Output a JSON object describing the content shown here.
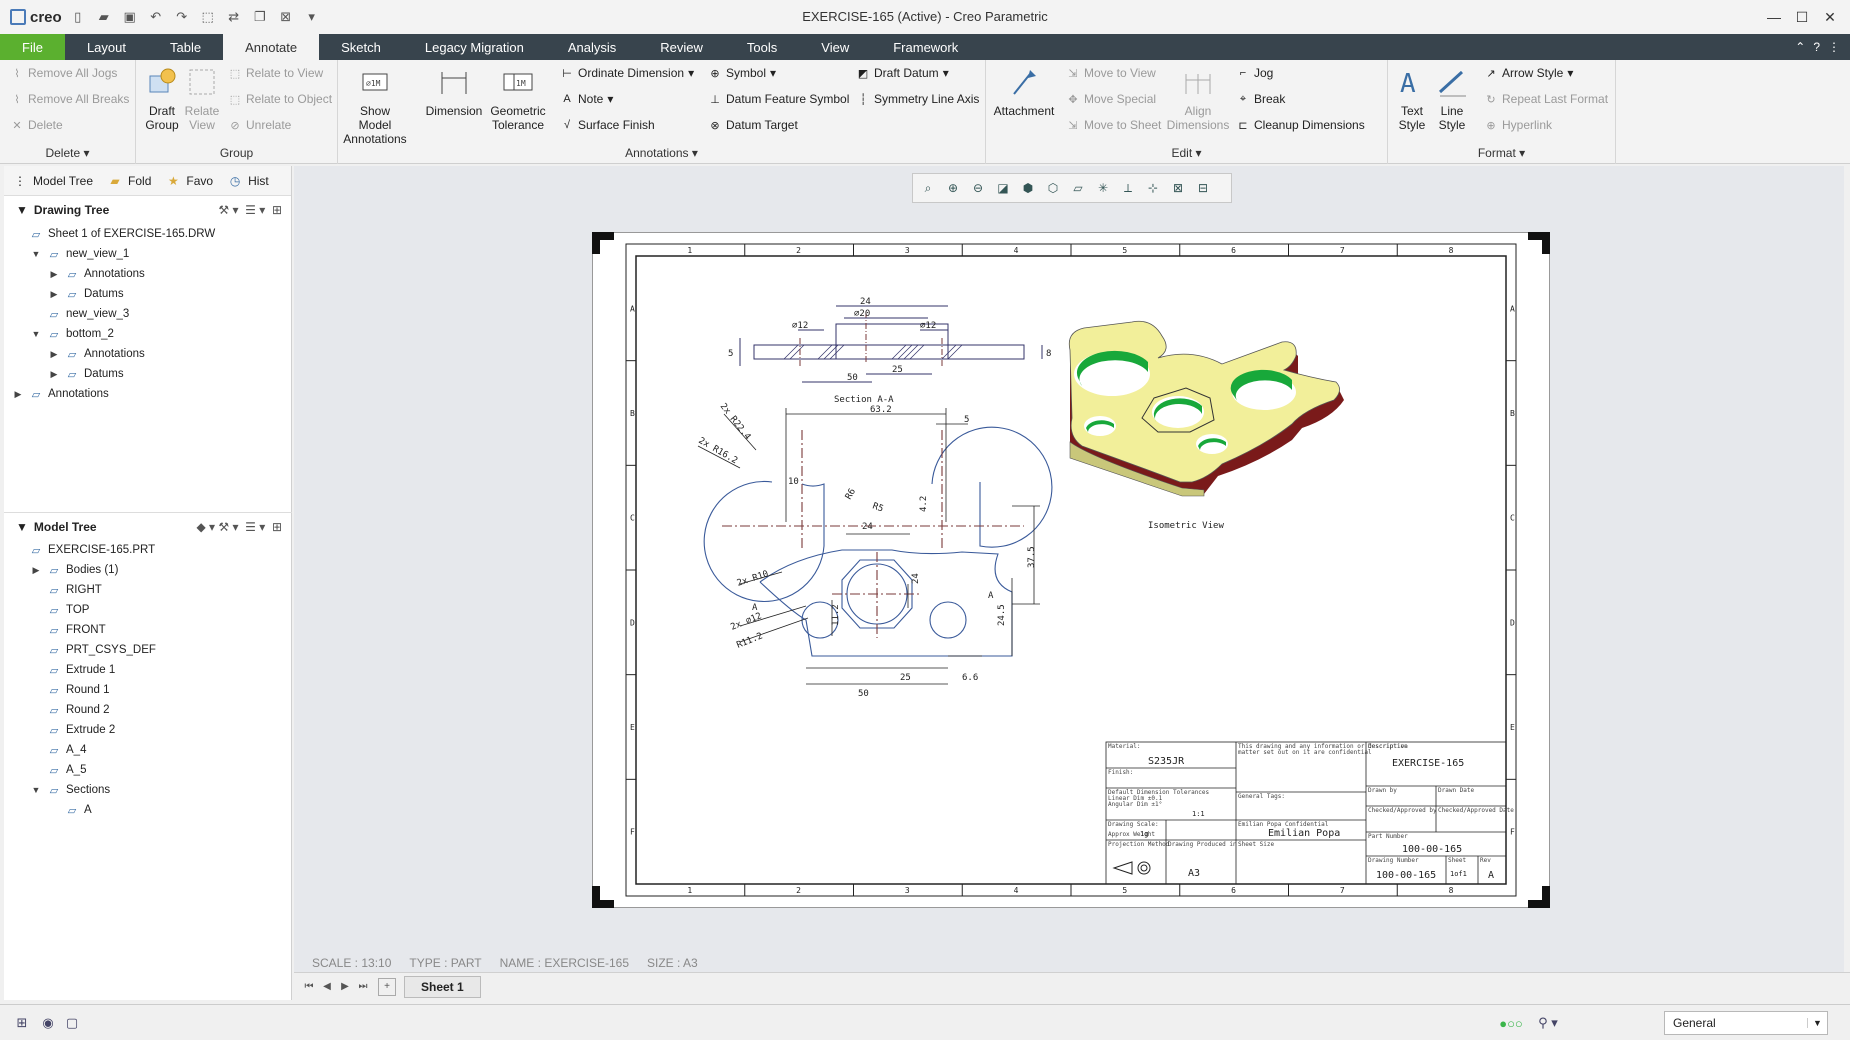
{
  "window": {
    "title": "EXERCISE-165 (Active) - Creo Parametric",
    "app": "creo"
  },
  "tabs": [
    "File",
    "Layout",
    "Table",
    "Annotate",
    "Sketch",
    "Legacy Migration",
    "Analysis",
    "Review",
    "Tools",
    "View",
    "Framework"
  ],
  "ribbon": {
    "delete": {
      "label": "Delete",
      "remove_all_jogs": "Remove All Jogs",
      "remove_all_breaks": "Remove All Breaks",
      "delete": "Delete"
    },
    "group": {
      "label": "Group",
      "draft_group": "Draft Group",
      "relate_view": "Relate View",
      "relate_to_view": "Relate to View",
      "relate_to_object": "Relate to Object",
      "unrelate": "Unrelate"
    },
    "annotations": {
      "label": "Annotations",
      "show_model_annotations": "Show Model Annotations",
      "dimension": "Dimension",
      "geometric_tolerance": "Geometric Tolerance",
      "ordinate_dimension": "Ordinate Dimension",
      "note": "Note",
      "surface_finish": "Surface Finish",
      "symbol": "Symbol",
      "datum_feature_symbol": "Datum Feature Symbol",
      "datum_target": "Datum Target",
      "draft_datum": "Draft Datum",
      "symmetry_line_axis": "Symmetry Line Axis"
    },
    "edit": {
      "label": "Edit",
      "attachment": "Attachment",
      "move_to_view": "Move to View",
      "move_special": "Move Special",
      "move_to_sheet": "Move to Sheet",
      "align_dimensions": "Align Dimensions",
      "jog": "Jog",
      "break": "Break",
      "cleanup_dimensions": "Cleanup Dimensions"
    },
    "format": {
      "label": "Format",
      "text_style": "Text Style",
      "line_style": "Line Style",
      "arrow_style": "Arrow Style",
      "repeat_last_format": "Repeat Last Format",
      "hyperlink": "Hyperlink"
    }
  },
  "panel_tabs": [
    "Model Tree",
    "Fold",
    "Favo",
    "Hist"
  ],
  "drawing_tree": {
    "header": "Drawing Tree",
    "items": [
      {
        "label": "Sheet 1 of EXERCISE-165.DRW",
        "indent": 0,
        "twisty": ""
      },
      {
        "label": "new_view_1",
        "indent": 1,
        "twisty": "▼"
      },
      {
        "label": "Annotations",
        "indent": 2,
        "twisty": "▶"
      },
      {
        "label": "Datums",
        "indent": 2,
        "twisty": "▶"
      },
      {
        "label": "new_view_3",
        "indent": 1,
        "twisty": ""
      },
      {
        "label": "bottom_2",
        "indent": 1,
        "twisty": "▼"
      },
      {
        "label": "Annotations",
        "indent": 2,
        "twisty": "▶"
      },
      {
        "label": "Datums",
        "indent": 2,
        "twisty": "▶"
      },
      {
        "label": "Annotations",
        "indent": 0,
        "twisty": "▶"
      }
    ]
  },
  "model_tree": {
    "header": "Model Tree",
    "items": [
      {
        "label": "EXERCISE-165.PRT",
        "indent": 0,
        "twisty": ""
      },
      {
        "label": "Bodies (1)",
        "indent": 1,
        "twisty": "▶"
      },
      {
        "label": "RIGHT",
        "indent": 1,
        "twisty": ""
      },
      {
        "label": "TOP",
        "indent": 1,
        "twisty": ""
      },
      {
        "label": "FRONT",
        "indent": 1,
        "twisty": ""
      },
      {
        "label": "PRT_CSYS_DEF",
        "indent": 1,
        "twisty": ""
      },
      {
        "label": "Extrude 1",
        "indent": 1,
        "twisty": ""
      },
      {
        "label": "Round 1",
        "indent": 1,
        "twisty": ""
      },
      {
        "label": "Round 2",
        "indent": 1,
        "twisty": ""
      },
      {
        "label": "Extrude 2",
        "indent": 1,
        "twisty": ""
      },
      {
        "label": "A_4",
        "indent": 1,
        "twisty": ""
      },
      {
        "label": "A_5",
        "indent": 1,
        "twisty": ""
      },
      {
        "label": "Sections",
        "indent": 1,
        "twisty": "▼"
      },
      {
        "label": "A",
        "indent": 2,
        "twisty": ""
      }
    ]
  },
  "drawing": {
    "section_label": "Section A-A",
    "isometric_label": "Isometric View",
    "dims": {
      "d24": "24",
      "d20": "⌀20",
      "d12a": "⌀12",
      "d12b": "⌀12",
      "d50a": "50",
      "d25a": "25",
      "d5a": "5",
      "d8": "8",
      "d63": "63.2",
      "d5b": "5",
      "r22": "2x R22.4",
      "r16": "2x R16.2",
      "d10": "10",
      "r6": "R6",
      "r5": "R5",
      "d42": "4.2",
      "d24b": "24",
      "d24c": "24",
      "d375": "37.5",
      "r10": "2x R10",
      "d12c": "2x ⌀12",
      "r11": "R11.2",
      "d112": "11.2",
      "d245": "24.5",
      "d25b": "25",
      "d66": "6.6",
      "d50b": "50",
      "labA1": "A",
      "labA2": "A"
    },
    "cols": [
      "1",
      "2",
      "3",
      "4",
      "5",
      "6",
      "7",
      "8"
    ],
    "rows": [
      "A",
      "B",
      "C",
      "D",
      "E",
      "F"
    ],
    "title_block": {
      "material": "S235JR",
      "description": "EXERCISE-165",
      "author": "Emilian Popa",
      "part_number": "100-00-165",
      "drawing_number": "100-00-165",
      "scale": "1:1",
      "size": "A3",
      "sheet": "1of1",
      "revision": "A",
      "mass": "1g"
    }
  },
  "status": {
    "scale": "SCALE : 13:10",
    "type": "TYPE : PART",
    "name": "NAME : EXERCISE-165",
    "size": "SIZE : A3"
  },
  "sheet_tab": "Sheet 1",
  "filter": "General"
}
